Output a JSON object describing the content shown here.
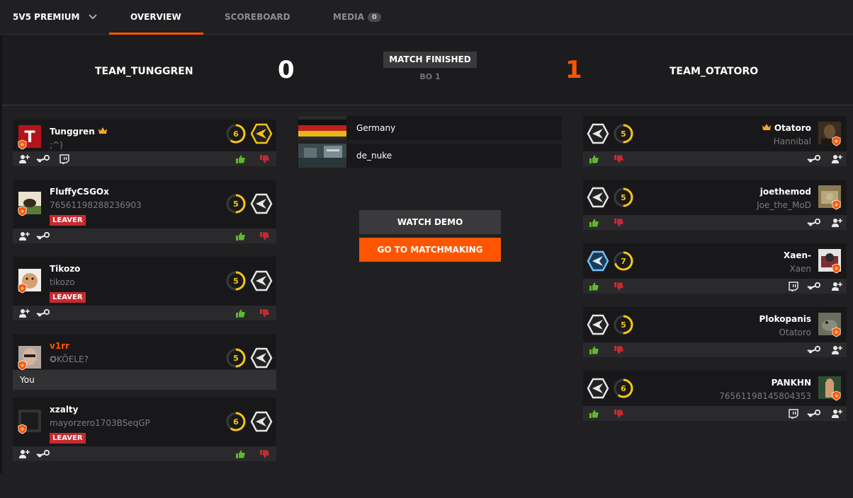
{
  "nav": {
    "mode": "5V5 PREMIUM",
    "tabs": {
      "overview": "OVERVIEW",
      "scoreboard": "SCOREBOARD",
      "media": "MEDIA"
    },
    "media_count": "0"
  },
  "match": {
    "team1": {
      "name": "TEAM_TUNGGREN",
      "score": "0"
    },
    "team2": {
      "name": "TEAM_OTATORO",
      "score": "1"
    },
    "status": "MATCH FINISHED",
    "format": "BO 1",
    "location": "Germany",
    "map": "de_nuke",
    "watch_demo": "WATCH DEMO",
    "go_to_matchmaking": "GO TO MATCHMAKING",
    "you_label": "You"
  },
  "team1_players": [
    {
      "name": "Tunggren",
      "sub": ";^)",
      "level": "6",
      "leader": true
    },
    {
      "name": "FluffyCSGOx",
      "sub": "76561198288236903",
      "level": "5",
      "leaver": "LEAVER"
    },
    {
      "name": "Tikozo",
      "sub": "tikozo",
      "level": "5",
      "leaver": "LEAVER"
    },
    {
      "name": "v1rr",
      "sub": "✪KÖELE?",
      "level": "5"
    },
    {
      "name": "xzalty",
      "sub": "mayorzero1703BSeqGP",
      "level": "6",
      "leaver": "LEAVER"
    }
  ],
  "team2_players": [
    {
      "name": "Otatoro",
      "sub": "Hannibal",
      "level": "5",
      "leader": true
    },
    {
      "name": "joethemod",
      "sub": "Joe_the_MoD",
      "level": "5"
    },
    {
      "name": "Xaen-",
      "sub": "Xaen",
      "level": "7"
    },
    {
      "name": "Plokopanis",
      "sub": "Otatoro",
      "level": "5"
    },
    {
      "name": "PANKHN",
      "sub": "76561198145804353",
      "level": "6"
    }
  ],
  "colors": {
    "accent": "#ff5500",
    "like": "#5fb82e",
    "dislike": "#c8292f",
    "level_ring": "#f5c518"
  },
  "icons": [
    "chevron-down-icon",
    "crown-icon",
    "add-friend-icon",
    "steam-icon",
    "twitch-icon",
    "thumbs-up-icon",
    "thumbs-down-icon",
    "level-icon",
    "rank-icon",
    "shield-icon"
  ]
}
